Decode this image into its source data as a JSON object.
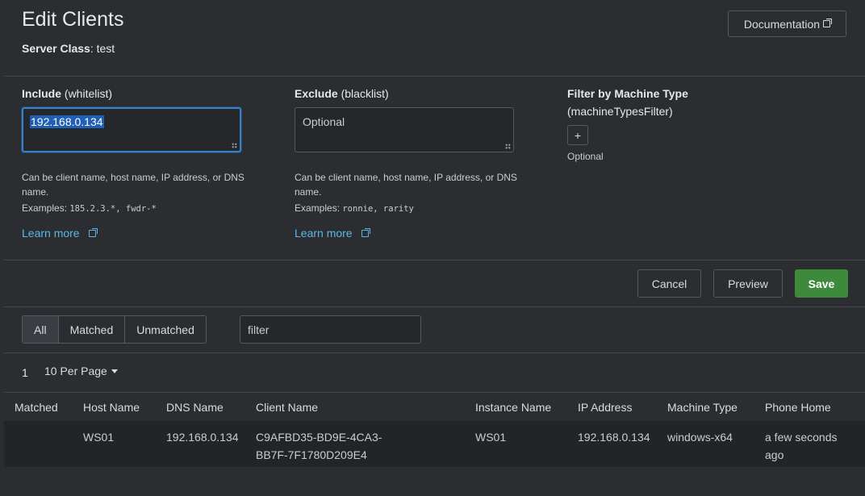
{
  "header": {
    "title": "Edit Clients",
    "server_class_label": "Server Class",
    "server_class_value": ": test",
    "doc_button": "Documentation"
  },
  "include": {
    "label_bold": "Include",
    "label_rest": " (whitelist)",
    "value": "192.168.0.134",
    "help": "Can be client name, host name, IP address, or DNS name.",
    "examples_label": "Examples: ",
    "examples_value": "185.2.3.*, fwdr-*",
    "learn_more": "Learn more"
  },
  "exclude": {
    "label_bold": "Exclude",
    "label_rest": " (blacklist)",
    "placeholder": "Optional",
    "help": "Can be client name, host name, IP address, or DNS name.",
    "examples_label": "Examples: ",
    "examples_value": "ronnie, rarity",
    "learn_more": "Learn more"
  },
  "machine_filter": {
    "label": "Filter by Machine Type",
    "sublabel": "(machineTypesFilter)",
    "add_label": "+",
    "optional": "Optional"
  },
  "actions": {
    "cancel": "Cancel",
    "preview": "Preview",
    "save": "Save"
  },
  "filter_tabs": {
    "all": "All",
    "matched": "Matched",
    "unmatched": "Unmatched",
    "selected": "All"
  },
  "search": {
    "placeholder": "filter"
  },
  "pager": {
    "page": "1",
    "per_page": "10 Per Page"
  },
  "table": {
    "columns": [
      "Matched",
      "Host Name",
      "DNS Name",
      "Client Name",
      "Instance Name",
      "IP Address",
      "Machine Type",
      "Phone Home"
    ],
    "rows": [
      {
        "matched": "",
        "host_name": "WS01",
        "dns_name": "192.168.0.134",
        "client_name_1": "C9AFBD35-BD9E-4CA3-",
        "client_name_2": "BB7F-7F1780D209E4",
        "instance_name": "WS01",
        "ip_address": "192.168.0.134",
        "machine_type": "windows-x64",
        "phone_home_1": "a few seconds",
        "phone_home_2": "ago"
      }
    ]
  },
  "colors": {
    "background": "#2b2d31",
    "accent_link": "#5bb8e6",
    "save_green": "#3d8a3d",
    "focus_blue": "#3b82c4"
  }
}
